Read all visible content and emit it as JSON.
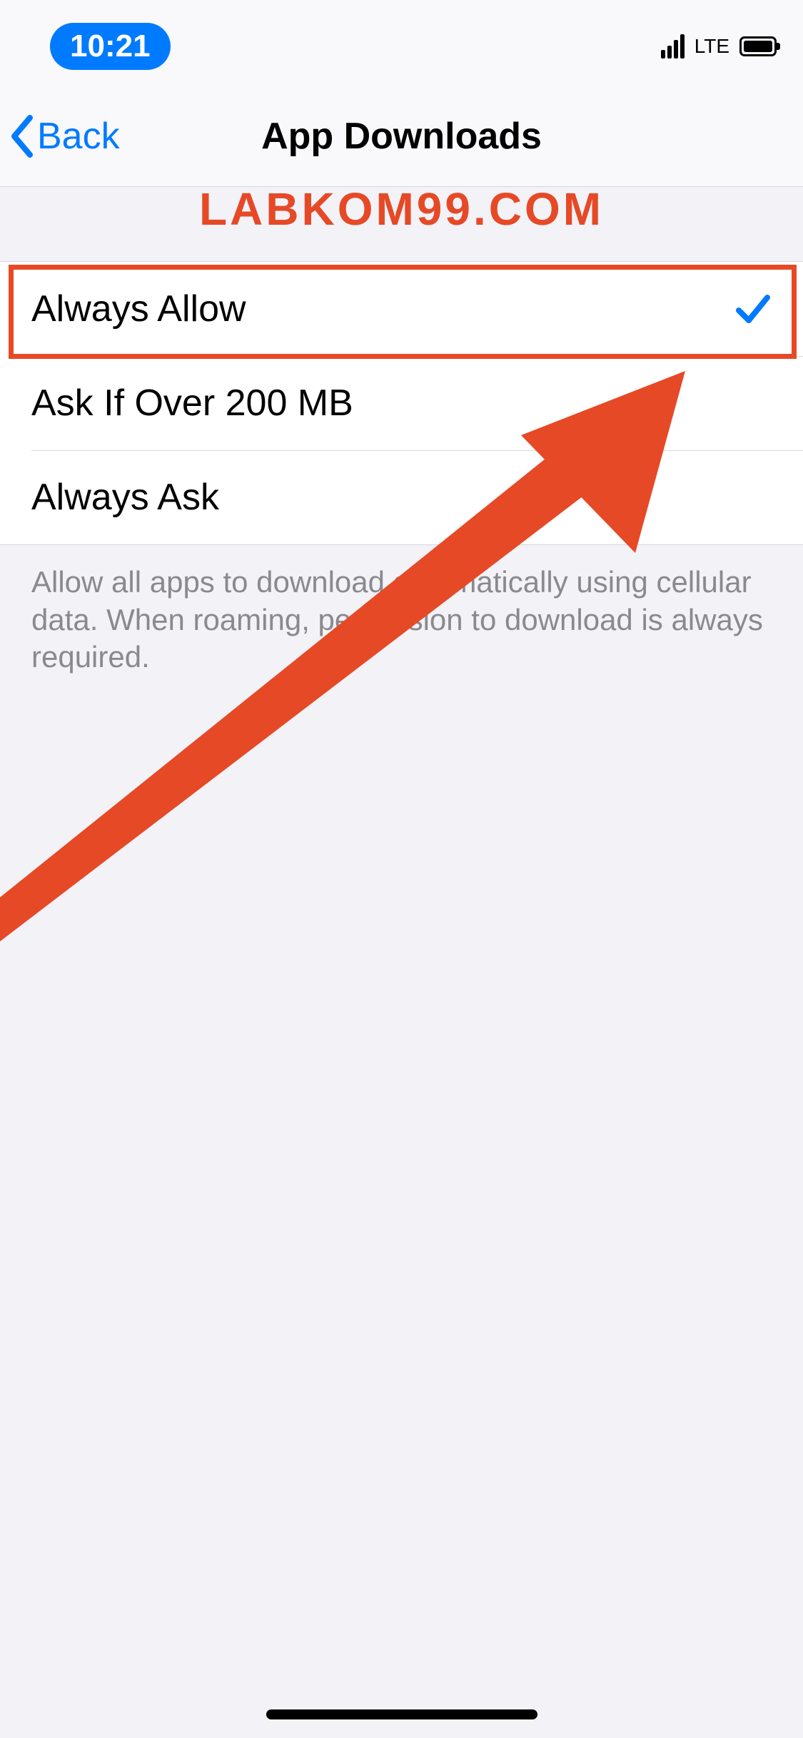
{
  "status": {
    "time": "10:21",
    "network_label": "LTE"
  },
  "nav": {
    "back_label": "Back",
    "title": "App Downloads"
  },
  "watermark_text": "LABKOM99.COM",
  "options": [
    {
      "label": "Always Allow",
      "selected": true
    },
    {
      "label": "Ask If Over 200 MB",
      "selected": false
    },
    {
      "label": "Always Ask",
      "selected": false
    }
  ],
  "footer_text": "Allow all apps to download automatically using cellular data. When roaming, permission to download is always required.",
  "colors": {
    "tint": "#007aff",
    "annotation": "#e64926"
  }
}
